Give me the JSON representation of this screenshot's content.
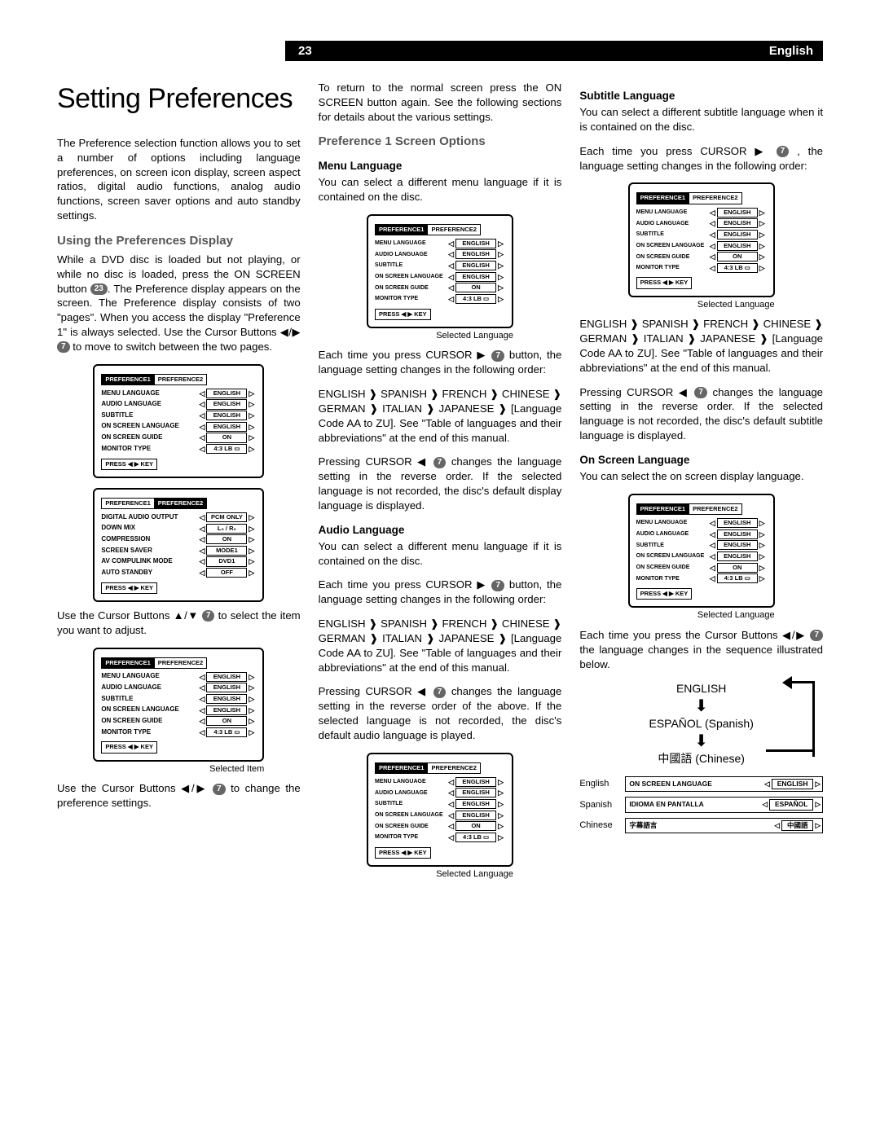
{
  "header": {
    "page": "23",
    "language": "English"
  },
  "title": "Setting Preferences",
  "intro": "The Preference selection function allows you to set a number of options including language preferences, on screen icon display, screen aspect ratios, digital audio functions, analog audio functions, screen saver options and auto standby settings.",
  "sec_using_head": "Using the Preferences Display",
  "using_p1a": "While a DVD disc is loaded but not playing, or while no disc is loaded, press the ON SCREEN button ",
  "badge23": "23",
  "using_p1b": ". The Preference display appears on the screen. The Preference display consists of two \"pages\". When you access the display \"Preference 1\" is always selected. Use the Cursor Buttons ◀/▶ ",
  "badge7": "7",
  "using_p1c": " to move    to switch between the two pages.",
  "using_p2": "Use the Cursor Buttons ▲/▼ ",
  "using_p2b": " to select the item you want to adjust.",
  "using_p3": "Use the Cursor Buttons ◀/▶ ",
  "using_p3b": " to change the preference settings.",
  "col2_intro": "To return to the normal screen press the ON SCREEN button again. See the following sections for details about the various settings.",
  "sec_pref1_head": "Preference 1 Screen Options",
  "menu_lang_head": "Menu Language",
  "menu_lang_p1": "You can select a different menu language if it is contained on the disc.",
  "cursor_each_a": "Each time you press CURSOR ▶ ",
  "cursor_each_b": " button, the language setting changes in the following order:",
  "lang_order": "ENGLISH ❱ SPANISH ❱ FRENCH ❱ CHINESE ❱ GERMAN ❱ ITALIAN ❱ JAPANESE ❱ [Language Code AA to ZU]. See \"Table of languages and their abbreviations\" at the end of this manual.",
  "cursor_rev_a": "Pressing CURSOR ◀ ",
  "cursor_rev_menu": " changes the language setting in the reverse order. If the selected language is not recorded, the disc's default display language is displayed.",
  "audio_lang_head": "Audio Language",
  "audio_lang_p1": "You can select a different menu language if it is contained on the disc.",
  "cursor_rev_audio": " changes the language setting in the reverse order of the above. If the selected language is not recorded, the disc's default audio language is played.",
  "subtitle_head": "Subtitle Language",
  "subtitle_p1": "You can select a different subtitle language when it is contained on the disc.",
  "subtitle_each_a": "Each time you press CURSOR ▶ ",
  "subtitle_each_b": " , the language setting changes in the following order:",
  "cursor_rev_sub": " changes the language setting in the reverse order. If the selected language is not recorded, the disc's default subtitle language is displayed.",
  "osl_head": "On Screen Language",
  "osl_p1": "You can select the on screen display language.",
  "osl_p2a": "Each time you press the Cursor Buttons ◀/▶ ",
  "osl_p2b": " the language changes in the sequence illustrated below.",
  "flow": {
    "a": "ENGLISH",
    "b": "ESPAÑOL (Spanish)",
    "c": "中國語 (Chinese)"
  },
  "examples": {
    "en": {
      "tag": "English",
      "label": "ON SCREEN LANGUAGE",
      "val": "ENGLISH"
    },
    "es": {
      "tag": "Spanish",
      "label": "IDIOMA EN PANTALLA",
      "val": "ESPAÑOL"
    },
    "zh": {
      "tag": "Chinese",
      "label": "字幕語言",
      "val": "中國語"
    }
  },
  "osd": {
    "tab1": "PREFERENCE1",
    "tab2": "PREFERENCE2",
    "rows1": [
      {
        "l": "MENU LANGUAGE",
        "v": "ENGLISH"
      },
      {
        "l": "AUDIO LANGUAGE",
        "v": "ENGLISH"
      },
      {
        "l": "SUBTITLE",
        "v": "ENGLISH"
      },
      {
        "l": "ON SCREEN LANGUAGE",
        "v": "ENGLISH"
      },
      {
        "l": "ON SCREEN GUIDE",
        "v": "ON"
      },
      {
        "l": "MONITOR TYPE",
        "v": "4:3 LB ▭"
      }
    ],
    "rows2": [
      {
        "l": "DIGITAL AUDIO OUTPUT",
        "v": "PCM ONLY"
      },
      {
        "l": "DOWN MIX",
        "v": "L₀ / R₀"
      },
      {
        "l": "COMPRESSION",
        "v": "ON"
      },
      {
        "l": "SCREEN SAVER",
        "v": "MODE1"
      },
      {
        "l": "AV COMPULINK MODE",
        "v": "DVD1"
      },
      {
        "l": "AUTO STANDBY",
        "v": "OFF"
      }
    ],
    "press": "PRESS ◀ ▶ KEY"
  },
  "cap_selected_item": "Selected Item",
  "cap_selected_lang": "Selected Language"
}
